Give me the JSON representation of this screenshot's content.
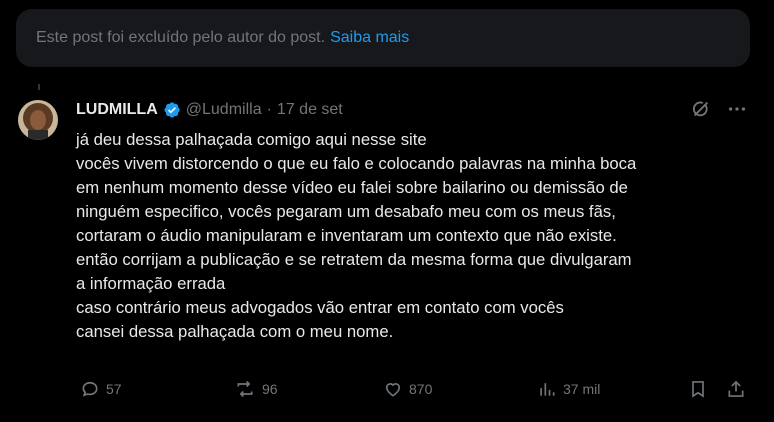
{
  "deleted_notice": {
    "text": "Este post foi excluído pelo autor do post.",
    "link": "Saiba mais"
  },
  "post": {
    "author_name": "LUDMILLA",
    "handle": "@Ludmilla",
    "separator": "·",
    "date": "17 de set",
    "verified": true,
    "lines": [
      "já deu dessa palhaçada comigo aqui nesse site",
      "vocês vivem distorcendo o que eu falo e colocando palavras na minha boca",
      "em nenhum momento desse vídeo eu falei sobre bailarino ou demissão de",
      "ninguém especifico, vocês pegaram um desabafo meu com os meus fãs,",
      "cortaram o áudio manipularam e inventaram um contexto que não existe.",
      "então corrijam a publicação e se retratem da mesma forma que divulgaram",
      "a informação errada",
      "caso contrário meus advogados vão entrar em contato com vocês",
      "cansei dessa palhaçada com o meu nome."
    ]
  },
  "actions": {
    "replies": "57",
    "reposts": "96",
    "likes": "870",
    "views": "37 mil"
  },
  "colors": {
    "background": "#000000",
    "text": "#e7e9ea",
    "muted": "#71767b",
    "accent": "#1d9bf0",
    "box": "#16181c"
  },
  "icons": [
    "verified-badge-icon",
    "grok-icon",
    "more-icon",
    "reply-icon",
    "repost-icon",
    "like-icon",
    "views-icon",
    "bookmark-icon",
    "share-icon"
  ]
}
